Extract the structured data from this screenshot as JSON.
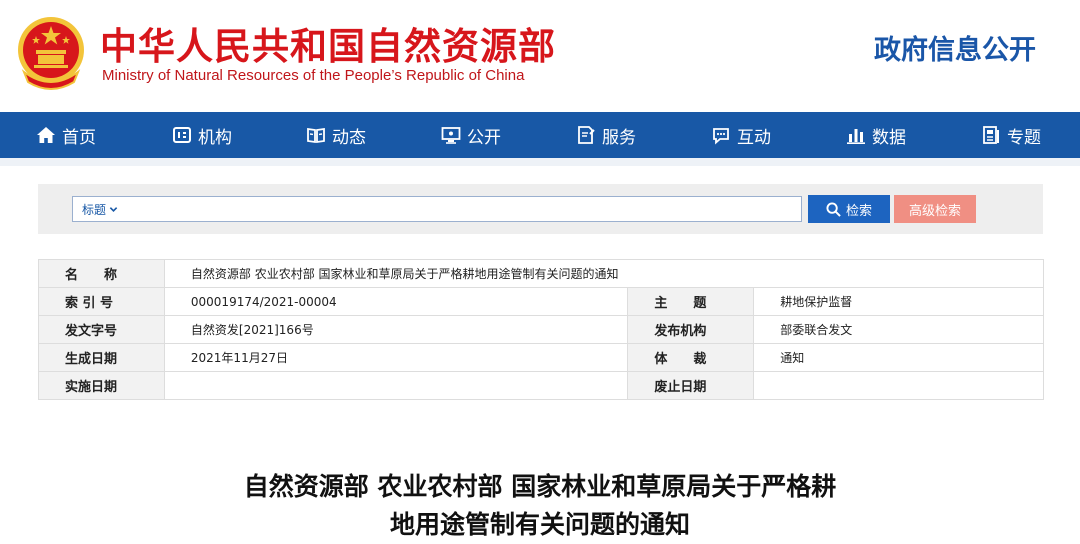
{
  "header": {
    "title": "中华人民共和国自然资源部",
    "subtitle": "Ministry of Natural Resources of the People’s Republic of China",
    "gov_info": "政府信息公开"
  },
  "colors": {
    "brand_red": "#d7161b",
    "nav_blue": "#1858a6",
    "search_blue": "#1d64c0",
    "advanced_salmon": "#f08f83"
  },
  "nav": {
    "items": [
      {
        "label": "首页",
        "icon": "home-icon"
      },
      {
        "label": "机构",
        "icon": "organization-icon"
      },
      {
        "label": "动态",
        "icon": "book-icon"
      },
      {
        "label": "公开",
        "icon": "monitor-icon"
      },
      {
        "label": "服务",
        "icon": "document-edit-icon"
      },
      {
        "label": "互动",
        "icon": "chat-icon"
      },
      {
        "label": "数据",
        "icon": "bar-chart-icon"
      },
      {
        "label": "专题",
        "icon": "topic-icon"
      }
    ]
  },
  "search": {
    "type_label": "标题",
    "value": "",
    "button_label": "检索",
    "advanced_label": "高级检索"
  },
  "info": {
    "name_label": "名　　称",
    "name_value": "自然资源部 农业农村部 国家林业和草原局关于严格耕地用途管制有关问题的通知",
    "index_label": "索 引 号",
    "index_value": "000019174/2021-00004",
    "subject_label": "主　　题",
    "subject_value": "耕地保护监督",
    "doc_no_label": "发文字号",
    "doc_no_value": "自然资发[2021]166号",
    "issuer_label": "发布机构",
    "issuer_value": "部委联合发文",
    "date_label": "生成日期",
    "date_value": "2021年11月27日",
    "genre_label": "体　　裁",
    "genre_value": "通知",
    "effective_label": "实施日期",
    "effective_value": "",
    "expiry_label": "废止日期",
    "expiry_value": ""
  },
  "document": {
    "title_line1": "自然资源部 农业农村部 国家林业和草原局关于严格耕",
    "title_line2": "地用途管制有关问题的通知"
  }
}
